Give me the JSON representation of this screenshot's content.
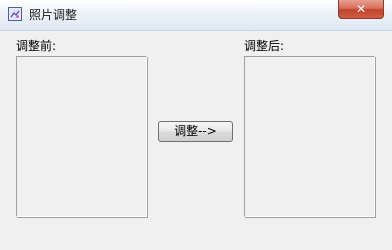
{
  "window": {
    "title": "照片调整",
    "close_label": "✕",
    "app_icon": "photo-adjust-icon"
  },
  "panels": {
    "before_label": "调整前:",
    "after_label": "调整后:"
  },
  "actions": {
    "adjust_label": "调整-->"
  },
  "colors": {
    "close_button": "#c1452c",
    "background": "#f0f0f0"
  }
}
